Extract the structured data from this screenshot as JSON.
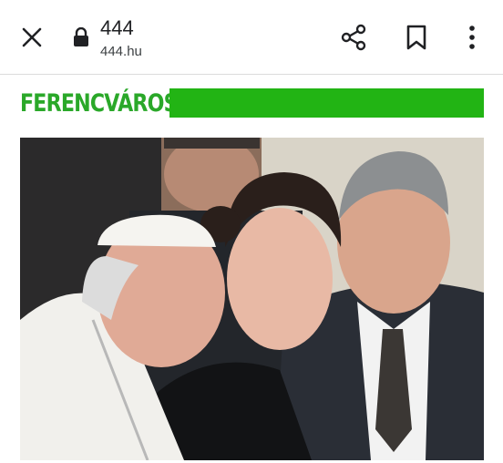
{
  "browser": {
    "site_title": "444",
    "site_url": "444.hu",
    "icons": [
      "close-icon",
      "lock-icon",
      "share-icon",
      "bookmark-icon",
      "more-vert-icon"
    ]
  },
  "article": {
    "section_label": "FERENCVÁROS",
    "accent_color": "#22b414"
  }
}
